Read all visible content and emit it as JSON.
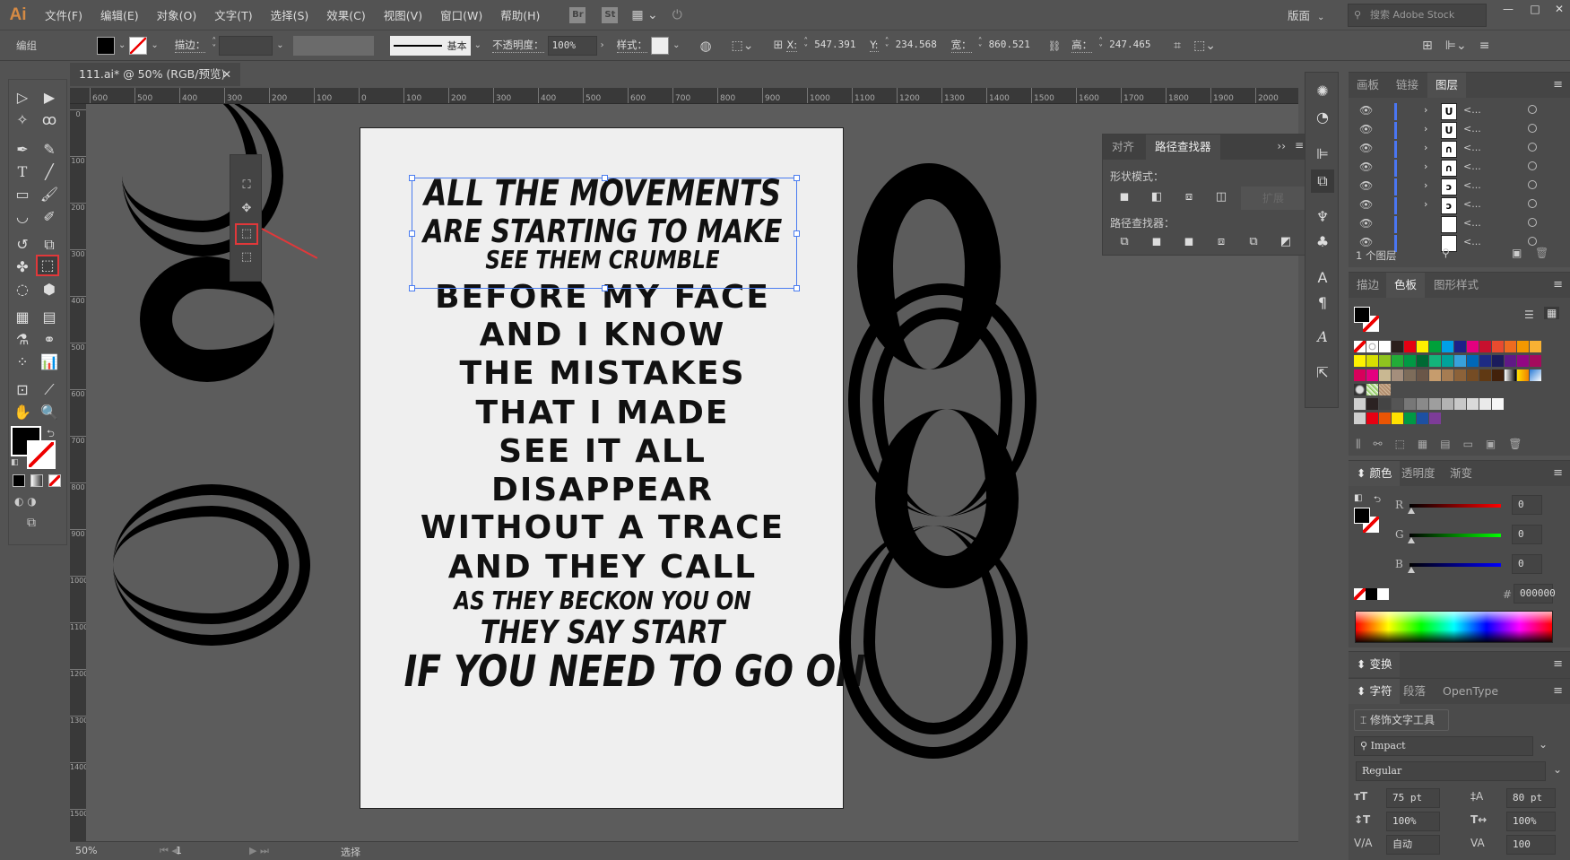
{
  "app": {
    "logo": "Ai"
  },
  "menu": [
    "文件(F)",
    "编辑(E)",
    "对象(O)",
    "文字(T)",
    "选择(S)",
    "效果(C)",
    "视图(V)",
    "窗口(W)",
    "帮助(H)"
  ],
  "menu_badges": [
    "Br",
    "St"
  ],
  "workspace": {
    "label": "版面",
    "search_placeholder": "搜索 Adobe Stock"
  },
  "window_controls": {
    "minimize": "—",
    "maximize": "□",
    "close": "✕"
  },
  "control_bar": {
    "selection_type": "编组",
    "stroke_label": "描边：",
    "brush_label": "基本",
    "opacity_label": "不透明度：",
    "opacity_value": "100%",
    "style_label": "样式：",
    "x_label": "X:",
    "x_value": "547.391",
    "y_label": "Y:",
    "y_value": "234.568",
    "w_label": "宽：",
    "w_value": "860.521",
    "h_label": "高：",
    "h_value": "247.465"
  },
  "document_tab": {
    "title": "111.ai* @ 50% (RGB/预览)",
    "close": "✕"
  },
  "ruler_h": [
    "600",
    "500",
    "400",
    "300",
    "200",
    "100",
    "0",
    "100",
    "200",
    "300",
    "400",
    "500",
    "600",
    "700",
    "800",
    "900",
    "1000",
    "1100",
    "1200",
    "1300",
    "1400",
    "1500",
    "1600",
    "1700",
    "1800",
    "1900",
    "2000"
  ],
  "ruler_v": [
    "0",
    "100",
    "200",
    "300",
    "400",
    "500",
    "600",
    "700",
    "800",
    "900",
    "1000",
    "1100",
    "1200",
    "1300",
    "1400",
    "1500"
  ],
  "artboard": {
    "lines": [
      {
        "text": "ALL THE MOVEMENTS",
        "style": "warp"
      },
      {
        "text": "ARE STARTING TO MAKE",
        "style": "warp"
      },
      {
        "text": "SEE THEM CRUMBLE",
        "style": "warp"
      },
      {
        "text": "BEFORE MY FACE",
        "style": "plain"
      },
      {
        "text": "AND I KNOW",
        "style": "plain"
      },
      {
        "text": "THE MISTAKES",
        "style": "plain"
      },
      {
        "text": "THAT I MADE",
        "style": "plain"
      },
      {
        "text": "SEE IT ALL",
        "style": "plain"
      },
      {
        "text": "DISAPPEAR",
        "style": "plain"
      },
      {
        "text": "WITHOUT A TRACE",
        "style": "plain"
      },
      {
        "text": "AND THEY CALL",
        "style": "plain"
      },
      {
        "text": "AS THEY BECKON YOU ON",
        "style": "warp"
      },
      {
        "text": "THEY SAY START",
        "style": "warp"
      },
      {
        "text": "IF YOU NEED TO GO ON",
        "style": "warp"
      }
    ]
  },
  "pathfinder_panel": {
    "tabs": [
      "对齐",
      "路径查找器"
    ],
    "active_tab": "路径查找器",
    "shape_modes_label": "形状模式：",
    "expand_label": "扩展",
    "pathfinders_label": "路径查找器："
  },
  "layers_panel": {
    "tabs": [
      "画板",
      "链接",
      "图层"
    ],
    "active_tab": "图层",
    "rows": [
      {
        "name": "<...",
        "thumb": "U",
        "expandable": true
      },
      {
        "name": "<...",
        "thumb": "U",
        "expandable": true
      },
      {
        "name": "<...",
        "thumb": "∩",
        "expandable": true
      },
      {
        "name": "<...",
        "thumb": "∩",
        "expandable": true
      },
      {
        "name": "<...",
        "thumb": "ↄ",
        "expandable": true
      },
      {
        "name": "<...",
        "thumb": "ↄ",
        "expandable": true
      },
      {
        "name": "<...",
        "thumb": "",
        "expandable": false
      },
      {
        "name": "<...",
        "thumb": "",
        "expandable": false
      }
    ],
    "footer": "1 个图层"
  },
  "swatches_panel": {
    "tabs": [
      "描边",
      "色板",
      "图形样式"
    ],
    "active_tab": "色板",
    "rows": [
      [
        "none",
        "register",
        "#ffffff",
        "#2b1f1c",
        "#e50012",
        "#fff000",
        "#00a13a",
        "#00a0e8",
        "#1d2088",
        "#e4007f",
        "#c8102e",
        "#e94b2f",
        "#ee6b20",
        "#f39800",
        "#f8b133"
      ],
      [
        "#fff100",
        "#d7df01",
        "#8fc31f",
        "#22ac38",
        "#009944",
        "#006934",
        "#13b47a",
        "#00a29a",
        "#38a1db",
        "#0068b7",
        "#1d2b84",
        "#1b1c5c",
        "#601986",
        "#920783",
        "#a40b5d"
      ],
      [
        "#d7005b",
        "#e4007f",
        "#c9b892",
        "#a48e7c",
        "#7d6c5a",
        "#6a5648",
        "#c69c6d",
        "#a67c52",
        "#8c6239",
        "#754c24",
        "#603913",
        "#42210b",
        "grad-bw",
        "grad-yellow",
        "grad-blue"
      ],
      [
        "pattern-dots",
        "pattern-green",
        "pattern-brown"
      ],
      [
        "folder",
        "#2b2222",
        "#444444",
        "#555555",
        "#777777",
        "#8a8a8a",
        "#9e9e9e",
        "#b3b3b3",
        "#c8c8c8",
        "#d9d9d9",
        "#eaeaea",
        "#f6f6f6"
      ],
      [
        "folder",
        "#e60012",
        "#ea5504",
        "#ffe100",
        "#009944",
        "#1d50a2",
        "#7d3c98"
      ]
    ]
  },
  "color_panel": {
    "tabs": [
      "颜色",
      "透明度",
      "渐变"
    ],
    "active_tab": "颜色",
    "channels": [
      {
        "label": "R",
        "value": "0",
        "color": "#ff0000"
      },
      {
        "label": "G",
        "value": "0",
        "color": "#00ff00"
      },
      {
        "label": "B",
        "value": "0",
        "color": "#0000ff"
      }
    ],
    "hex_label": "#",
    "hex_value": "000000"
  },
  "transform_panel": {
    "title": "变换"
  },
  "character_panel": {
    "tabs": [
      "字符",
      "段落",
      "OpenType"
    ],
    "active_tab": "字符",
    "touch_type_label": "修饰文字工具",
    "font_family": "Impact",
    "font_style": "Regular",
    "font_size": "75 pt",
    "leading": "80 pt",
    "vertical_scale": "100%",
    "horizontal_scale": "100%",
    "kerning": "自动",
    "tracking": "100"
  },
  "status_bar": {
    "zoom": "50%",
    "artboard": "1",
    "tool": "选择"
  }
}
